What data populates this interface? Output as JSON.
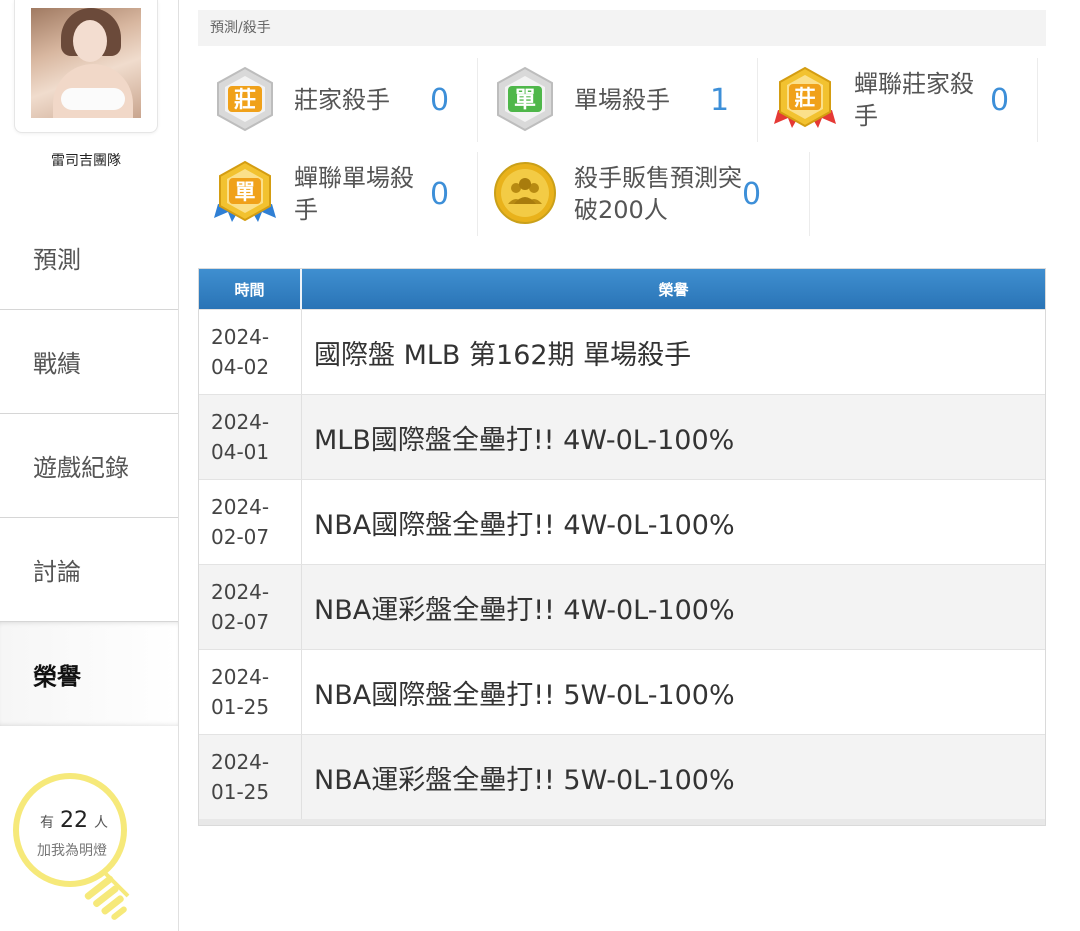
{
  "breadcrumb": "預測/殺手",
  "team": {
    "name": "雷司吉團隊"
  },
  "nav": [
    {
      "label": "預測"
    },
    {
      "label": "戰績"
    },
    {
      "label": "遊戲紀錄"
    },
    {
      "label": "討論"
    },
    {
      "label": "榮譽",
      "active": true
    }
  ],
  "follow": {
    "prefix": "有",
    "count": "22",
    "suffix": "人",
    "text": "加我為明燈"
  },
  "badges": [
    {
      "label": "莊家殺手",
      "count": "0",
      "icon_char": "莊",
      "icon": "banker-killer-icon"
    },
    {
      "label": "單場殺手",
      "count": "1",
      "icon_char": "單",
      "icon": "single-killer-icon"
    },
    {
      "label": "蟬聯莊家殺手",
      "count": "0",
      "icon_char": "莊",
      "icon": "streak-banker-killer-icon"
    },
    {
      "label": "蟬聯單場殺手",
      "count": "0",
      "icon_char": "單",
      "icon": "streak-single-killer-icon"
    },
    {
      "label": "殺手販售預測突破200人",
      "count": "0",
      "icon": "sales-milestone-icon"
    }
  ],
  "honor_table": {
    "headers": [
      "時間",
      "榮譽"
    ],
    "rows": [
      {
        "date1": "2024-",
        "date2": "04-02",
        "honor": "國際盤 MLB 第162期 單場殺手"
      },
      {
        "date1": "2024-",
        "date2": "04-01",
        "honor": "MLB國際盤全壘打!! 4W-0L-100%"
      },
      {
        "date1": "2024-",
        "date2": "02-07",
        "honor": "NBA國際盤全壘打!! 4W-0L-100%"
      },
      {
        "date1": "2024-",
        "date2": "02-07",
        "honor": "NBA運彩盤全壘打!! 4W-0L-100%"
      },
      {
        "date1": "2024-",
        "date2": "01-25",
        "honor": "NBA國際盤全壘打!! 5W-0L-100%"
      },
      {
        "date1": "2024-",
        "date2": "01-25",
        "honor": "NBA運彩盤全壘打!! 5W-0L-100%"
      }
    ]
  },
  "colors": {
    "accent": "#3d8fd8",
    "header_blue": "#2a74b6",
    "gold": "#e7b21c",
    "silver": "#cfcfcf",
    "bulb_yellow": "#f6e97a"
  }
}
